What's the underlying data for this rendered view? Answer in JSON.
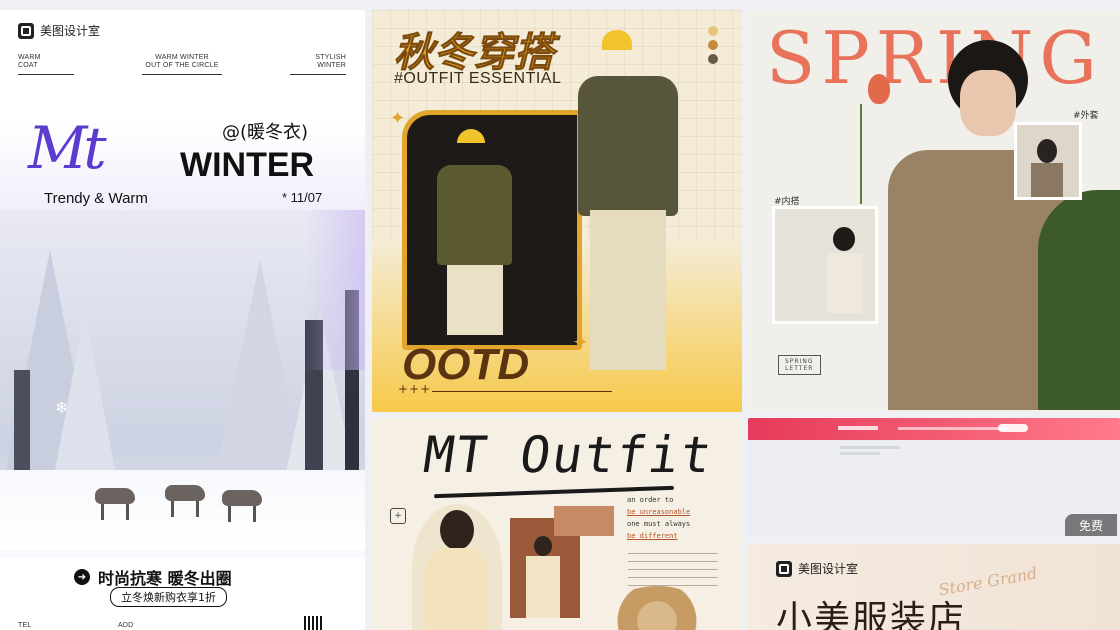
{
  "card1": {
    "brand": "美图设计室",
    "taglines": [
      {
        "line1": "WARM",
        "line2": "COAT"
      },
      {
        "line1": "WARM WINTER",
        "line2": "OUT OF THE CIRCLE"
      },
      {
        "line1": "STYLISH",
        "line2": "WINTER"
      }
    ],
    "mt": "Mt",
    "handle": "@(暖冬衣)",
    "winter": "WINTER",
    "subtitle": "Trendy & Warm",
    "date": "* 11/07",
    "slogan": "时尚抗寒 暖冬出圈",
    "promo": "立冬焕新购衣享1折",
    "tel": "TEL",
    "add": "ADD"
  },
  "card2": {
    "title": "秋冬穿搭",
    "subtitle": "#OUTFIT ESSENTIAL",
    "ootd": "OOTD",
    "plus": "+++"
  },
  "card3": {
    "title": "SPRING",
    "tag_outer": "#外套",
    "tag_inner": "#内搭",
    "stamp_line1": "SPRING",
    "stamp_line2": "LETTER"
  },
  "card4": {
    "title": "MT Outfit",
    "lines": [
      "an order to",
      "be unreasonable",
      "one must always",
      "be different"
    ]
  },
  "card5": {
    "badge": "免费"
  },
  "card6": {
    "brand": "美图设计室",
    "script": "Store Grand",
    "title": "小美服装店"
  },
  "colors": {
    "winter_purple": "#5b3ccf",
    "ootd_brown": "#5a3410",
    "spring_coral": "#e8735a",
    "store_brown": "#2d1e14"
  }
}
